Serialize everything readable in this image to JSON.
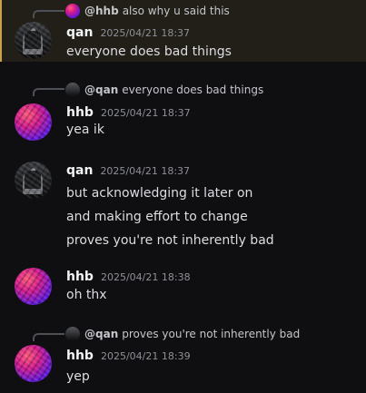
{
  "messages": [
    {
      "reply": {
        "author": "@hhb",
        "text": "also why u said this"
      },
      "author": "qan",
      "timestamp": "2025/04/21 18:37",
      "lines": [
        "everyone does bad things"
      ]
    },
    {
      "reply": {
        "author": "@qan",
        "text": "everyone does bad things"
      },
      "author": "hhb",
      "timestamp": "2025/04/21 18:37",
      "lines": [
        "yea ik"
      ]
    },
    {
      "author": "qan",
      "timestamp": "2025/04/21 18:37",
      "lines": [
        "but acknowledging it later on",
        "and making effort to change",
        "proves you're not inherently bad"
      ]
    },
    {
      "author": "hhb",
      "timestamp": "2025/04/21 18:38",
      "lines": [
        "oh thx"
      ]
    },
    {
      "reply": {
        "author": "@qan",
        "text": "proves you're not inherently bad"
      },
      "author": "hhb",
      "timestamp": "2025/04/21 18:39",
      "lines": [
        "yep"
      ]
    }
  ],
  "theme": {
    "background": "#0f0f12",
    "highlight_background": "#221f18",
    "highlight_bar": "#c9a14a"
  }
}
